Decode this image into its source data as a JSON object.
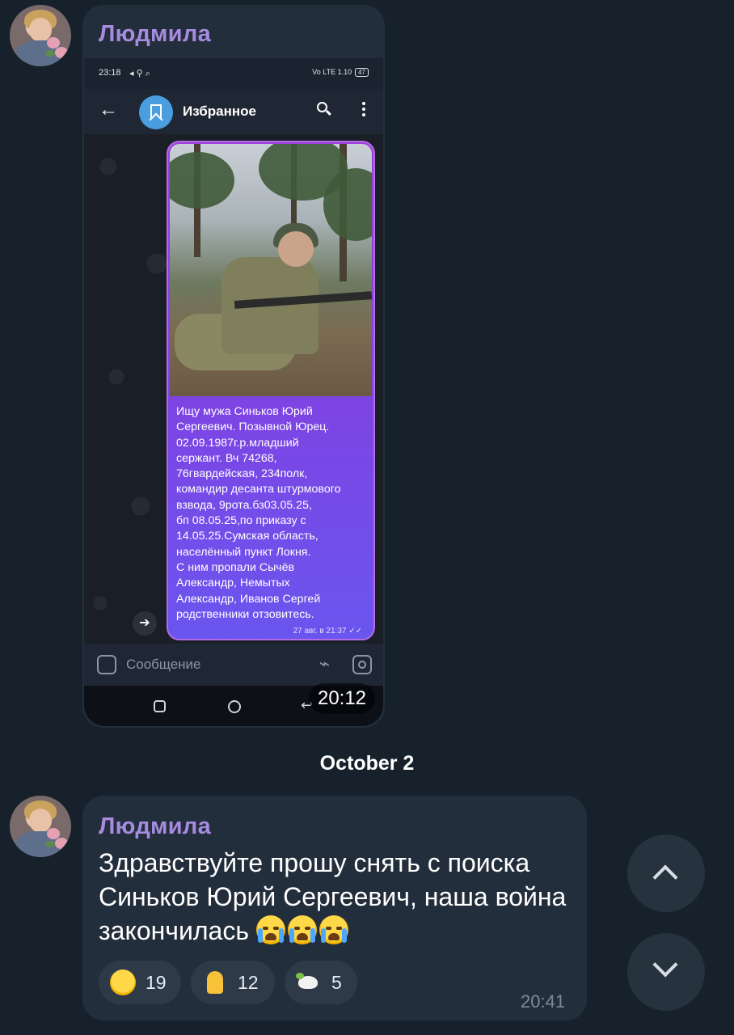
{
  "messages": [
    {
      "sender": "Людмила",
      "time_badge": "20:12",
      "screenshot": {
        "status_time": "23:18",
        "status_right": "Vo LTE 1.10",
        "battery": "47",
        "chat_title": "Избранное",
        "caption": "Ищу мужа Синьков Юрий\nСергеевич. Позывной Юрец.\n02.09.1987г.р.младший\nсержант. Вч 74268,\n76гвардейская, 234полк,\nкомандир десанта штурмового\nвзвода, 9рота.бз03.05.25,\nбп 08.05.25,по приказу с\n14.05.25.Сумская область,\nнаселённый пункт Локня.\nС ним пропали Сычёв\nАлександр, Немытых\nАлександр, Иванов Сергей\nродственники отзовитесь.",
        "caption_time": "27 авг. в 21:37 ✓✓",
        "input_placeholder": "Сообщение"
      }
    },
    {
      "sender": "Людмила",
      "text": "Здравствуйте прошу снять с поиска Синьков Юрий Сергеевич, наша война закончилась",
      "emojis": [
        "loudly-crying-face",
        "loudly-crying-face",
        "loudly-crying-face"
      ],
      "time": "20:41",
      "reactions": [
        {
          "emoji": "crying-face",
          "count": "19"
        },
        {
          "emoji": "folded-hands",
          "count": "12"
        },
        {
          "emoji": "dove",
          "count": "5"
        }
      ]
    }
  ],
  "date_separator": "October 2",
  "scroll_buttons": [
    "scroll-up",
    "scroll-down"
  ],
  "colors": {
    "background": "#17212b",
    "bubble": "#232e3c",
    "sender_name": "#a78bdf",
    "reaction_bg": "#2f3a48",
    "time": "#7b8a99"
  }
}
